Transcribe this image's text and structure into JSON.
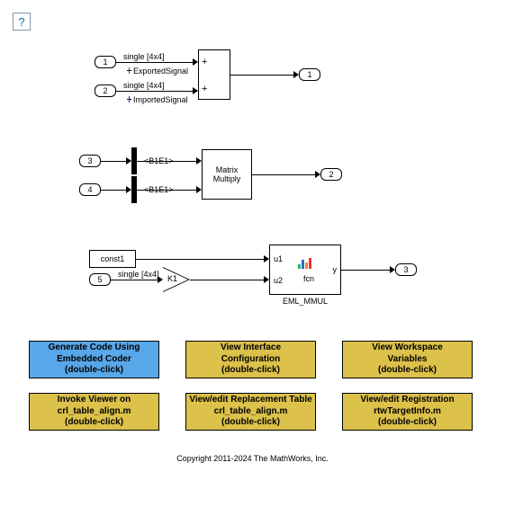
{
  "help": "?",
  "ports": {
    "in1": "1",
    "in2": "2",
    "in3": "3",
    "in4": "4",
    "in5": "5",
    "out1": "1",
    "out2": "2",
    "out3": "3"
  },
  "signals": {
    "single4x4_a": "single [4x4]",
    "single4x4_b": "single [4x4]",
    "single4x4_c": "single [4x4]",
    "exported": "ExportedSignal",
    "imported": "ImportedSignal",
    "b1e1_a": "<B1E1>",
    "b1e1_b": "<B1E1>"
  },
  "blocks": {
    "sum_plus1": "+",
    "sum_plus2": "+",
    "matmul": "Matrix\nMultiply",
    "const1": "const1",
    "gain": "K1",
    "eml_u1": "u1",
    "eml_u2": "u2",
    "eml_y": "y",
    "eml_fcn": "fcn",
    "eml_name": "EML_MMUL"
  },
  "annots": {
    "gen": "Generate Code Using\nEmbedded Coder\n(double-click)",
    "viewif": "View Interface\nConfiguration\n(double-click)",
    "viewws": "View Workspace\nVariables\n(double-click)",
    "viewer": "Invoke Viewer on\ncrl_table_align.m\n(double-click)",
    "editcrl": "View/edit Replacement Table\ncrl_table_align.m\n(double-click)",
    "editreg": "View/edit Registration\nrtwTargetInfo.m\n(double-click)"
  },
  "copyright": "Copyright 2011-2024 The MathWorks, Inc."
}
